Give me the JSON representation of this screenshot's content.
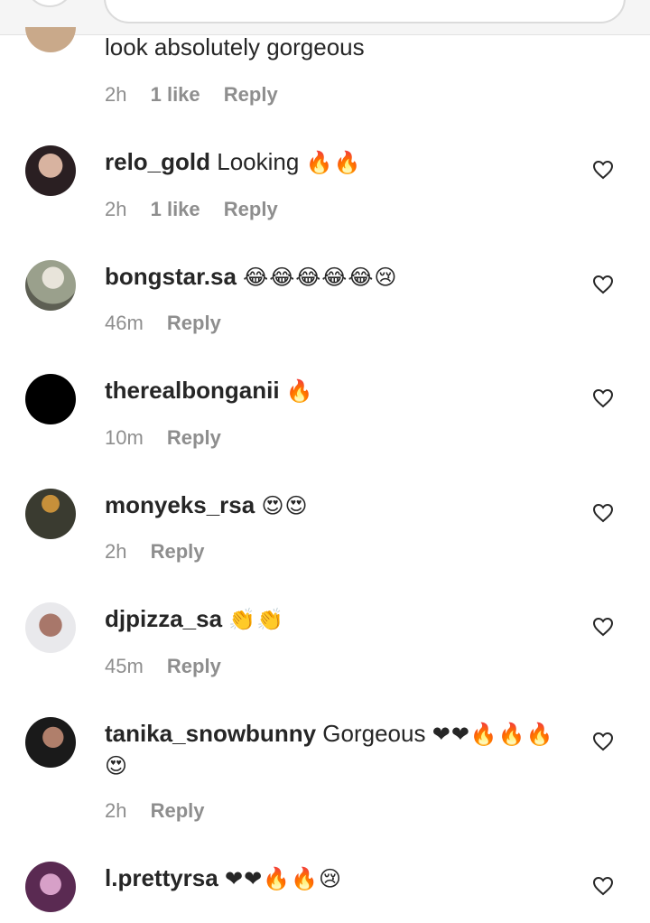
{
  "comments": [
    {
      "user": "",
      "text": "look absolutely gorgeous",
      "emoji": "",
      "time": "2h",
      "likes": "1 like",
      "reply": "Reply"
    },
    {
      "user": "relo_gold",
      "text": "Looking",
      "emoji": "🔥🔥",
      "time": "2h",
      "likes": "1 like",
      "reply": "Reply"
    },
    {
      "user": "bongstar.sa",
      "text": "",
      "emoji": "😂😂😂😂😂😢",
      "time": "46m",
      "likes": "",
      "reply": "Reply"
    },
    {
      "user": "therealbonganii",
      "text": "",
      "emoji": "🔥",
      "time": "10m",
      "likes": "",
      "reply": "Reply"
    },
    {
      "user": "monyeks_rsa",
      "text": "",
      "emoji": "😍😍",
      "time": "2h",
      "likes": "",
      "reply": "Reply"
    },
    {
      "user": "djpizza_sa",
      "text": "",
      "emoji": "👏👏",
      "time": "45m",
      "likes": "",
      "reply": "Reply"
    },
    {
      "user": "tanika_snowbunny",
      "text": "Gorgeous",
      "emoji": "❤❤🔥🔥🔥",
      "emoji2": "😍",
      "time": "2h",
      "likes": "",
      "reply": "Reply"
    },
    {
      "user": "l.prettyrsa",
      "text": "",
      "emoji": "❤❤🔥🔥😢",
      "time": "",
      "likes": "",
      "reply": ""
    }
  ],
  "colors": {
    "username": "#262626",
    "meta": "#8e8e8e",
    "heart_stroke": "#262626"
  }
}
